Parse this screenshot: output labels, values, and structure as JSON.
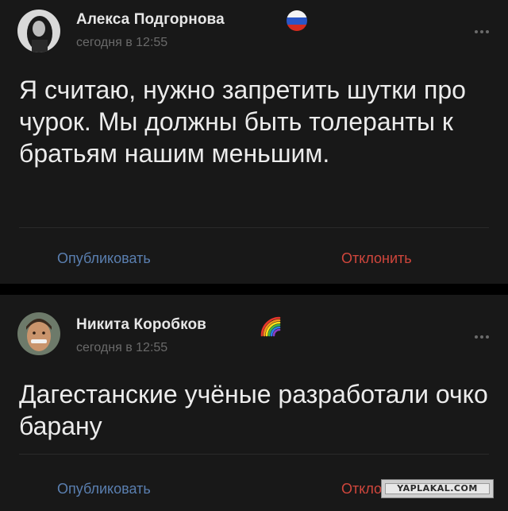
{
  "posts": [
    {
      "author": "Алекса Подгорнова",
      "badge": "russian-flag-icon",
      "time": "сегодня в 12:55",
      "text": "Я считаю, нужно запретить шутки про чурок. Мы должны быть толеранты к братьям нашим меньшим.",
      "publish_label": "Опубликовать",
      "decline_label": "Отклонить"
    },
    {
      "author": "Никита Коробков",
      "badge": "rainbow-icon",
      "time": "сегодня в 12:55",
      "text": "Дагестанские учёные разработали очко барану",
      "publish_label": "Опубликовать",
      "decline_label": "Отклонить"
    }
  ],
  "watermark": "YAPLAKAL.COM",
  "colors": {
    "card_bg": "#181818",
    "page_bg": "#000000",
    "publish": "#5a7fb0",
    "decline": "#d0463c"
  }
}
